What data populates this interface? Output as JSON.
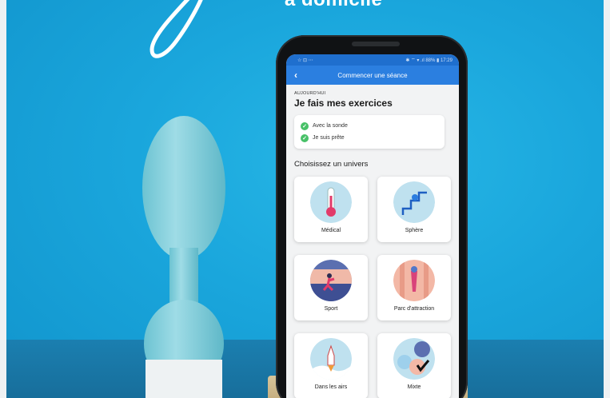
{
  "headline": "à domicile",
  "status_bar": {
    "left_icons": "☆ ⊡ ⋯",
    "right_text": "✱ ⌔ ▾ .ıl 88% ▮ 17:29"
  },
  "app_bar": {
    "title": "Commencer une séance"
  },
  "screen": {
    "overline": "AUJOURD'HUI",
    "title": "Je fais mes exercices",
    "checklist": [
      {
        "label": "Avec la sonde"
      },
      {
        "label": "Je suis prête"
      }
    ],
    "section_title": "Choisissez un univers",
    "universes": [
      {
        "label": "Médical",
        "icon": "thermometer-icon"
      },
      {
        "label": "Sphère",
        "icon": "sphere-stairs-icon"
      },
      {
        "label": "Sport",
        "icon": "runner-icon"
      },
      {
        "label": "Parc d'attraction",
        "icon": "carousel-icon"
      },
      {
        "label": "Dans les airs",
        "icon": "rocket-icon"
      },
      {
        "label": "Mixte",
        "icon": "mixed-icon"
      }
    ]
  },
  "colors": {
    "background": "#1aa6dc",
    "app_bar": "#2b7fe0",
    "check": "#48c168",
    "toy": "#8fd3df"
  }
}
